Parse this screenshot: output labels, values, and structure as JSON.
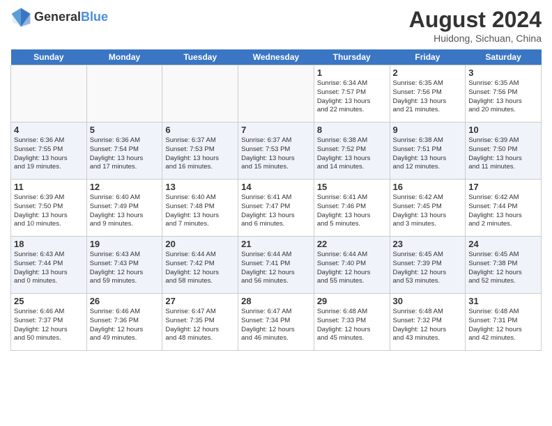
{
  "header": {
    "logo_general": "General",
    "logo_blue": "Blue",
    "month_year": "August 2024",
    "location": "Huidong, Sichuan, China"
  },
  "weekdays": [
    "Sunday",
    "Monday",
    "Tuesday",
    "Wednesday",
    "Thursday",
    "Friday",
    "Saturday"
  ],
  "weeks": [
    [
      {
        "day": "",
        "info": ""
      },
      {
        "day": "",
        "info": ""
      },
      {
        "day": "",
        "info": ""
      },
      {
        "day": "",
        "info": ""
      },
      {
        "day": "1",
        "info": "Sunrise: 6:34 AM\nSunset: 7:57 PM\nDaylight: 13 hours\nand 22 minutes."
      },
      {
        "day": "2",
        "info": "Sunrise: 6:35 AM\nSunset: 7:56 PM\nDaylight: 13 hours\nand 21 minutes."
      },
      {
        "day": "3",
        "info": "Sunrise: 6:35 AM\nSunset: 7:56 PM\nDaylight: 13 hours\nand 20 minutes."
      }
    ],
    [
      {
        "day": "4",
        "info": "Sunrise: 6:36 AM\nSunset: 7:55 PM\nDaylight: 13 hours\nand 19 minutes."
      },
      {
        "day": "5",
        "info": "Sunrise: 6:36 AM\nSunset: 7:54 PM\nDaylight: 13 hours\nand 17 minutes."
      },
      {
        "day": "6",
        "info": "Sunrise: 6:37 AM\nSunset: 7:53 PM\nDaylight: 13 hours\nand 16 minutes."
      },
      {
        "day": "7",
        "info": "Sunrise: 6:37 AM\nSunset: 7:53 PM\nDaylight: 13 hours\nand 15 minutes."
      },
      {
        "day": "8",
        "info": "Sunrise: 6:38 AM\nSunset: 7:52 PM\nDaylight: 13 hours\nand 14 minutes."
      },
      {
        "day": "9",
        "info": "Sunrise: 6:38 AM\nSunset: 7:51 PM\nDaylight: 13 hours\nand 12 minutes."
      },
      {
        "day": "10",
        "info": "Sunrise: 6:39 AM\nSunset: 7:50 PM\nDaylight: 13 hours\nand 11 minutes."
      }
    ],
    [
      {
        "day": "11",
        "info": "Sunrise: 6:39 AM\nSunset: 7:50 PM\nDaylight: 13 hours\nand 10 minutes."
      },
      {
        "day": "12",
        "info": "Sunrise: 6:40 AM\nSunset: 7:49 PM\nDaylight: 13 hours\nand 9 minutes."
      },
      {
        "day": "13",
        "info": "Sunrise: 6:40 AM\nSunset: 7:48 PM\nDaylight: 13 hours\nand 7 minutes."
      },
      {
        "day": "14",
        "info": "Sunrise: 6:41 AM\nSunset: 7:47 PM\nDaylight: 13 hours\nand 6 minutes."
      },
      {
        "day": "15",
        "info": "Sunrise: 6:41 AM\nSunset: 7:46 PM\nDaylight: 13 hours\nand 5 minutes."
      },
      {
        "day": "16",
        "info": "Sunrise: 6:42 AM\nSunset: 7:45 PM\nDaylight: 13 hours\nand 3 minutes."
      },
      {
        "day": "17",
        "info": "Sunrise: 6:42 AM\nSunset: 7:44 PM\nDaylight: 13 hours\nand 2 minutes."
      }
    ],
    [
      {
        "day": "18",
        "info": "Sunrise: 6:43 AM\nSunset: 7:44 PM\nDaylight: 13 hours\nand 0 minutes."
      },
      {
        "day": "19",
        "info": "Sunrise: 6:43 AM\nSunset: 7:43 PM\nDaylight: 12 hours\nand 59 minutes."
      },
      {
        "day": "20",
        "info": "Sunrise: 6:44 AM\nSunset: 7:42 PM\nDaylight: 12 hours\nand 58 minutes."
      },
      {
        "day": "21",
        "info": "Sunrise: 6:44 AM\nSunset: 7:41 PM\nDaylight: 12 hours\nand 56 minutes."
      },
      {
        "day": "22",
        "info": "Sunrise: 6:44 AM\nSunset: 7:40 PM\nDaylight: 12 hours\nand 55 minutes."
      },
      {
        "day": "23",
        "info": "Sunrise: 6:45 AM\nSunset: 7:39 PM\nDaylight: 12 hours\nand 53 minutes."
      },
      {
        "day": "24",
        "info": "Sunrise: 6:45 AM\nSunset: 7:38 PM\nDaylight: 12 hours\nand 52 minutes."
      }
    ],
    [
      {
        "day": "25",
        "info": "Sunrise: 6:46 AM\nSunset: 7:37 PM\nDaylight: 12 hours\nand 50 minutes."
      },
      {
        "day": "26",
        "info": "Sunrise: 6:46 AM\nSunset: 7:36 PM\nDaylight: 12 hours\nand 49 minutes."
      },
      {
        "day": "27",
        "info": "Sunrise: 6:47 AM\nSunset: 7:35 PM\nDaylight: 12 hours\nand 48 minutes."
      },
      {
        "day": "28",
        "info": "Sunrise: 6:47 AM\nSunset: 7:34 PM\nDaylight: 12 hours\nand 46 minutes."
      },
      {
        "day": "29",
        "info": "Sunrise: 6:48 AM\nSunset: 7:33 PM\nDaylight: 12 hours\nand 45 minutes."
      },
      {
        "day": "30",
        "info": "Sunrise: 6:48 AM\nSunset: 7:32 PM\nDaylight: 12 hours\nand 43 minutes."
      },
      {
        "day": "31",
        "info": "Sunrise: 6:48 AM\nSunset: 7:31 PM\nDaylight: 12 hours\nand 42 minutes."
      }
    ]
  ]
}
